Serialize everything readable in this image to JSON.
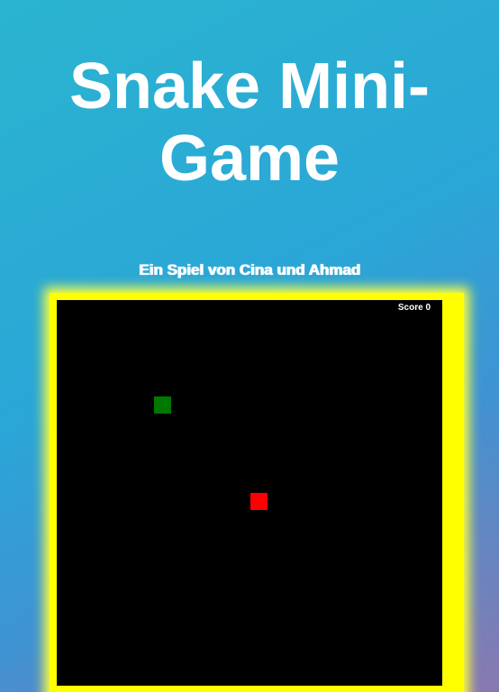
{
  "header": {
    "title": "Snake Mini-Game",
    "subtitle": "Ein Spiel von Cina und Ahmad"
  },
  "game": {
    "score_label": "Score",
    "score_value": "0",
    "colors": {
      "board": "#000000",
      "border": "#ffff00",
      "food": "#007800",
      "snake": "#ff0000"
    }
  }
}
